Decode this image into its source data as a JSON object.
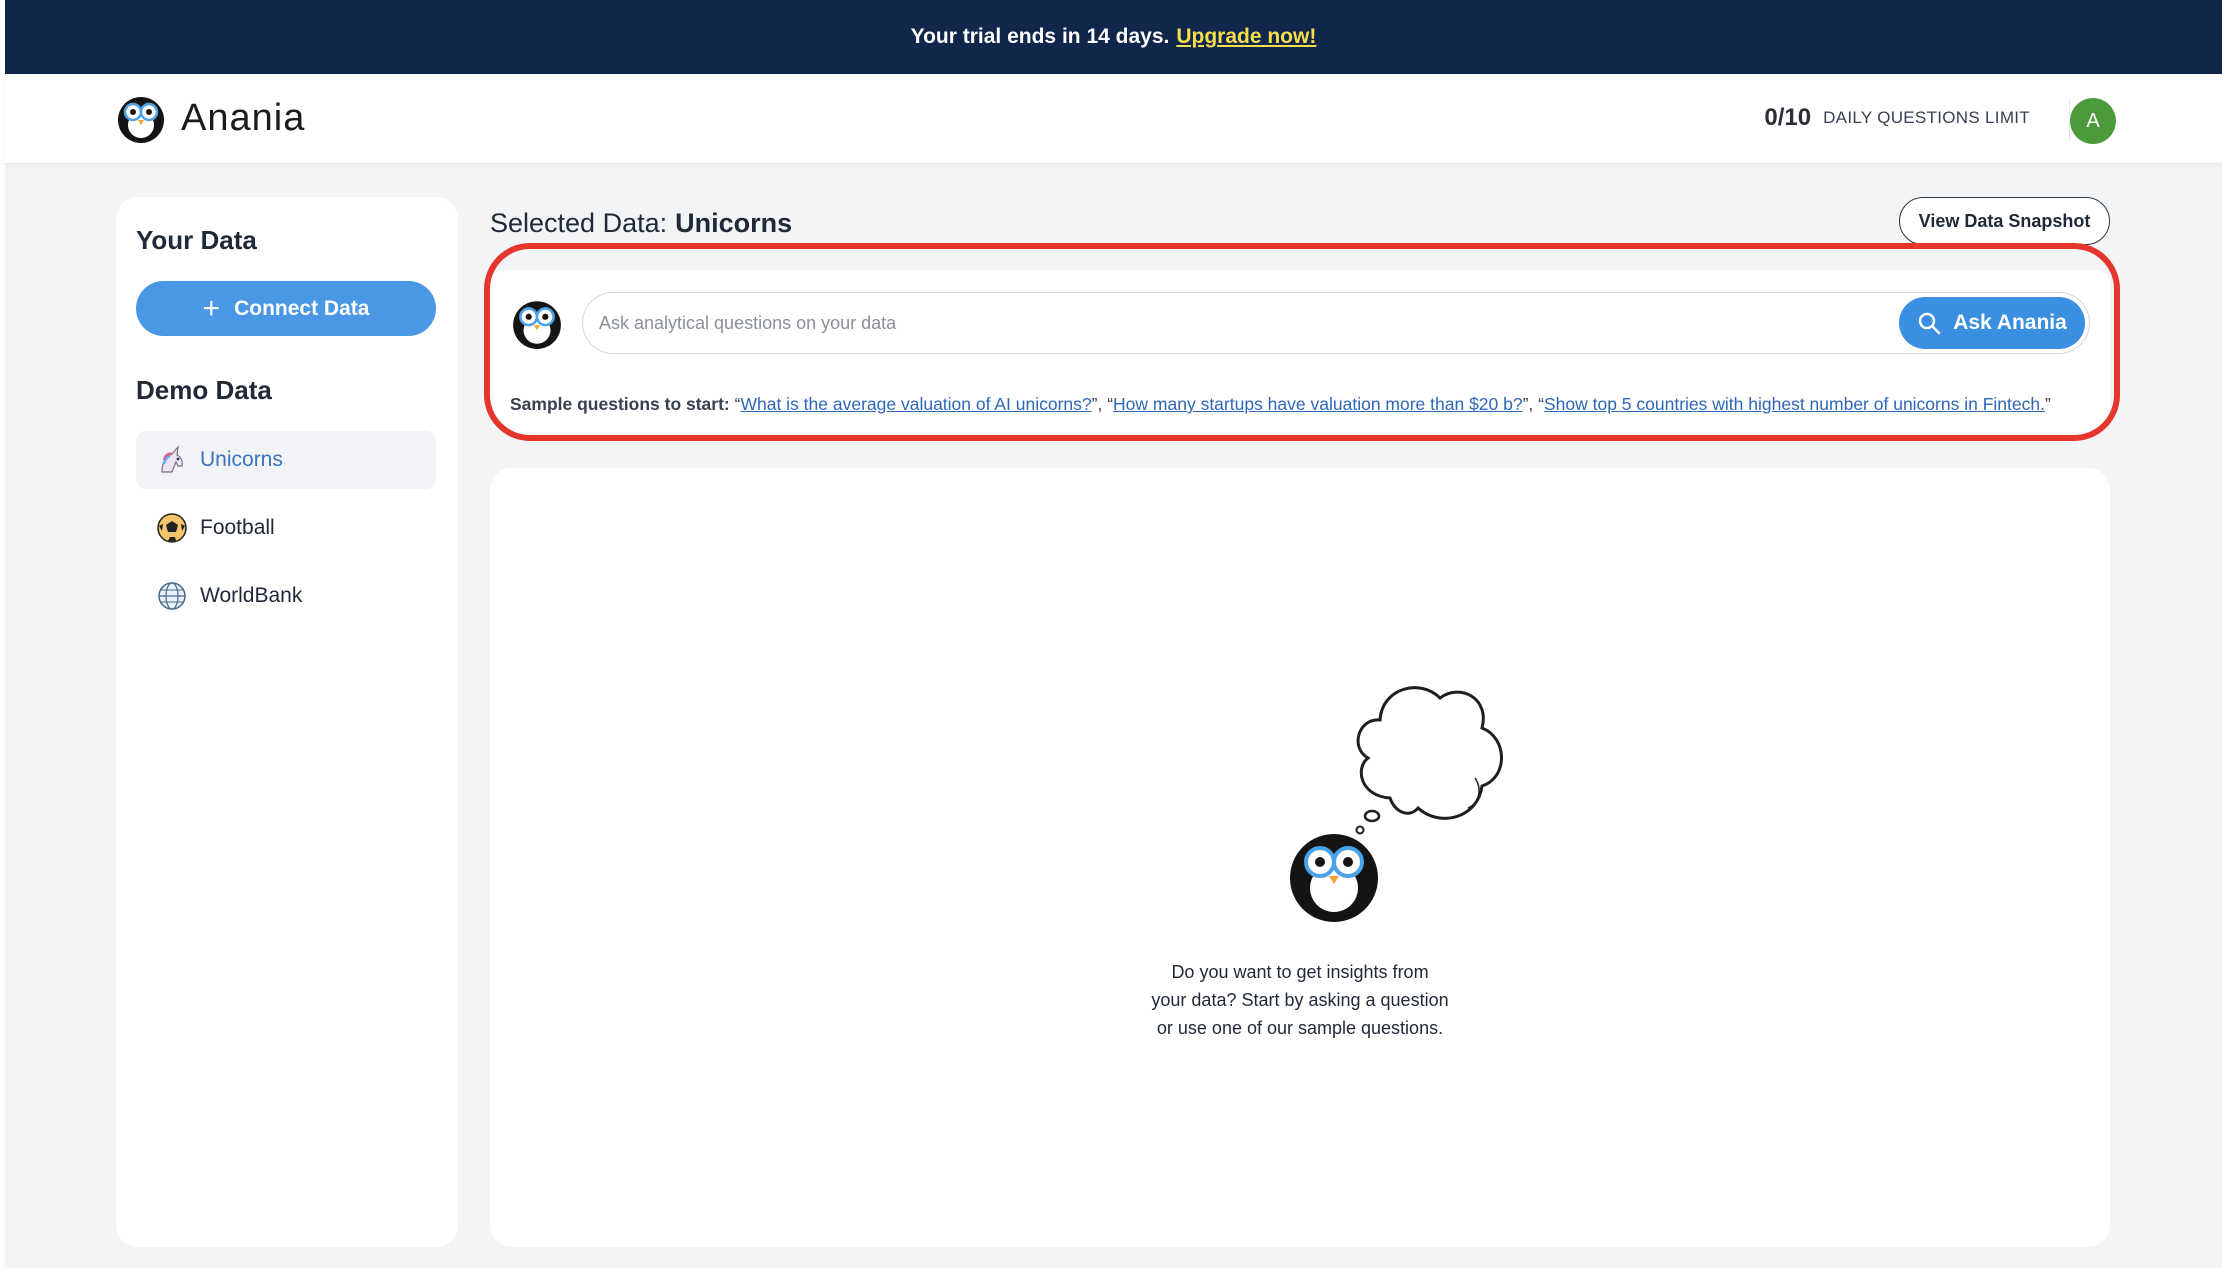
{
  "banner": {
    "message": "Your trial ends in 14 days.",
    "link_label": "Upgrade now!"
  },
  "header": {
    "logo_text": "Anania",
    "limit_count": "0/10",
    "limit_label": "DAILY QUESTIONS LIMIT",
    "avatar_initial": "A"
  },
  "sidebar": {
    "your_data_heading": "Your Data",
    "connect_label": "Connect Data",
    "demo_heading": "Demo Data",
    "items": [
      {
        "label": "Unicorns",
        "icon": "unicorn-icon",
        "active": true
      },
      {
        "label": "Football",
        "icon": "football-icon",
        "active": false
      },
      {
        "label": "WorldBank",
        "icon": "globe-icon",
        "active": false
      }
    ]
  },
  "main": {
    "selected_prefix": "Selected Data:",
    "selected_name": "Unicorns",
    "snapshot_label": "View Data Snapshot",
    "ask": {
      "placeholder": "Ask analytical questions on your data",
      "value": "",
      "button_label": "Ask Anania"
    },
    "samples": {
      "lead": "Sample questions to start:",
      "questions": [
        "What is the average valuation of AI unicorns?",
        "How many startups have valuation more than $20 b?",
        "Show top 5 countries with highest number of unicorns in Fintech."
      ]
    },
    "empty_state": {
      "line1": "Do you want to get insights from",
      "line2": "your data? Start by asking a question",
      "line3": "or use one of our sample questions."
    }
  },
  "colors": {
    "banner_bg": "#10264a",
    "banner_link": "#f5dd4b",
    "primary": "#4a97e6",
    "avatar": "#4c9a3c",
    "highlight": "#e5362d",
    "link": "#2e67b8"
  }
}
